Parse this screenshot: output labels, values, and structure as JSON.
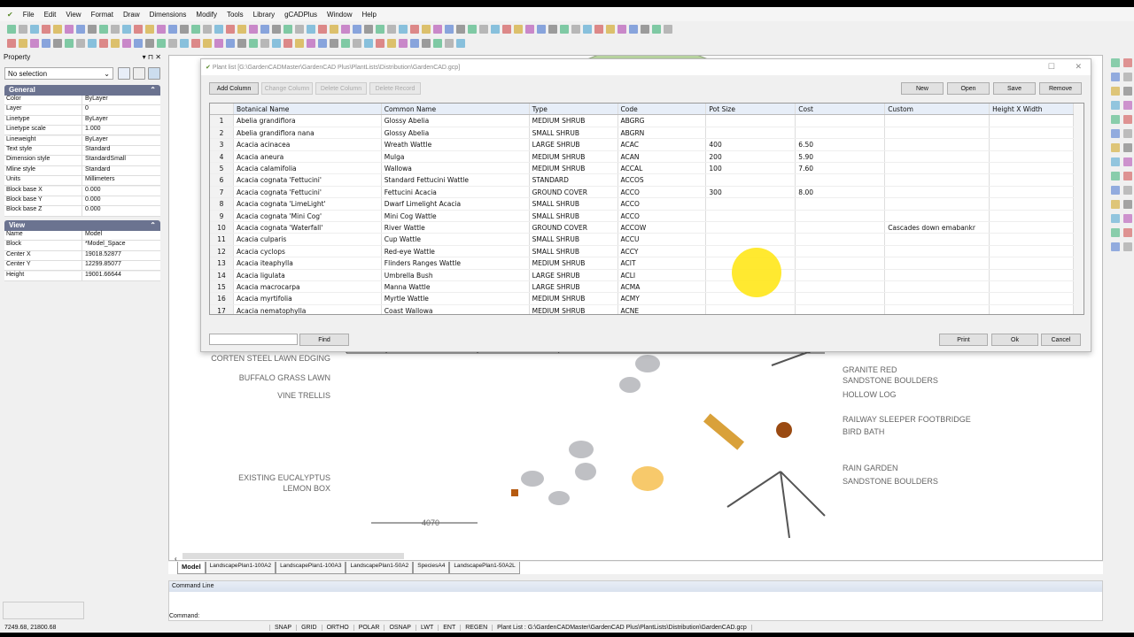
{
  "menu": [
    "File",
    "Edit",
    "View",
    "Format",
    "Draw",
    "Dimensions",
    "Modify",
    "Tools",
    "Library",
    "gCADPlus",
    "Window",
    "Help"
  ],
  "property": {
    "title": "Property",
    "selection": "No selection",
    "general_label": "General",
    "general": [
      [
        "Color",
        "ByLayer"
      ],
      [
        "Layer",
        "0"
      ],
      [
        "Linetype",
        "ByLayer"
      ],
      [
        "Linetype scale",
        "1.000"
      ],
      [
        "Lineweight",
        "ByLayer"
      ],
      [
        "Text style",
        "Standard"
      ],
      [
        "Dimension style",
        "StandardSmall"
      ],
      [
        "Mline style",
        "Standard"
      ],
      [
        "Units",
        "Millimeters"
      ],
      [
        "Block base X",
        "0.000"
      ],
      [
        "Block base Y",
        "0.000"
      ],
      [
        "Block base Z",
        "0.000"
      ]
    ],
    "view_label": "View",
    "view": [
      [
        "Name",
        "Model"
      ],
      [
        "Block",
        "*Model_Space"
      ],
      [
        "Center X",
        "19018.52877"
      ],
      [
        "Center Y",
        "12299.85077"
      ],
      [
        "Height",
        "19001.66644"
      ]
    ]
  },
  "dialog": {
    "title": "Plant list [G:\\GardenCADMaster\\GardenCAD Plus\\PlantLists\\Distribution\\GardenCAD.gcp]",
    "buttons_left": [
      "Add Column",
      "Change Column",
      "Delete Column",
      "Delete Record"
    ],
    "buttons_right": [
      "New",
      "Open",
      "Save",
      "Remove"
    ],
    "find": "Find",
    "print": "Print",
    "ok": "Ok",
    "cancel": "Cancel",
    "columns": [
      "Botanical Name",
      "Common Name",
      "Type",
      "Code",
      "Pot Size",
      "Cost",
      "Custom",
      "Height X Width"
    ],
    "rows": [
      [
        "1",
        "Abelia grandiflora",
        "Glossy Abelia",
        "MEDIUM SHRUB",
        "ABGRG",
        "",
        "",
        "",
        ""
      ],
      [
        "2",
        "Abelia grandiflora nana",
        "Glossy Abelia",
        "SMALL SHRUB",
        "ABGRN",
        "",
        "",
        "",
        ""
      ],
      [
        "3",
        "Acacia acinacea",
        "Wreath Wattle",
        "LARGE SHRUB",
        "ACAC",
        "400",
        "6.50",
        "",
        ""
      ],
      [
        "4",
        "Acacia aneura",
        "Mulga",
        "MEDIUM SHRUB",
        "ACAN",
        "200",
        "5.90",
        "",
        ""
      ],
      [
        "5",
        "Acacia calamifolia",
        "Wallowa",
        "MEDIUM SHRUB",
        "ACCAL",
        "100",
        "7.60",
        "",
        ""
      ],
      [
        "6",
        "Acacia cognata 'Fettucini'",
        "Standard Fettucini Wattle",
        "STANDARD",
        "ACCOS",
        "",
        "",
        "",
        ""
      ],
      [
        "7",
        "Acacia cognata 'Fettucini'",
        "Fettucini Acacia",
        "GROUND COVER",
        "ACCO",
        "300",
        "8.00",
        "",
        ""
      ],
      [
        "8",
        "Acacia cognata 'LimeLight'",
        "Dwarf Limelight Acacia",
        "SMALL SHRUB",
        "ACCO",
        "",
        "",
        "",
        ""
      ],
      [
        "9",
        "Acacia cognata 'Mini Cog'",
        "Mini Cog Wattle",
        "SMALL SHRUB",
        "ACCO",
        "",
        "",
        "",
        ""
      ],
      [
        "10",
        "Acacia cognata 'Waterfall'",
        "River Wattle",
        "GROUND COVER",
        "ACCOW",
        "",
        "",
        "Cascades down emabankr",
        ""
      ],
      [
        "11",
        "Acacia culparis",
        "Cup Wattle",
        "SMALL SHRUB",
        "ACCU",
        "",
        "",
        "",
        ""
      ],
      [
        "12",
        "Acacia cyclops",
        "Red-eye Wattle",
        "SMALL SHRUB",
        "ACCY",
        "",
        "",
        "",
        ""
      ],
      [
        "13",
        "Acacia iteaphylla",
        "Flinders Ranges Wattle",
        "MEDIUM SHRUB",
        "ACIT",
        "",
        "",
        "",
        ""
      ],
      [
        "14",
        "Acacia ligulata",
        "Umbrella Bush",
        "LARGE SHRUB",
        "ACLI",
        "",
        "",
        "",
        ""
      ],
      [
        "15",
        "Acacia macrocarpa",
        "Manna Wattle",
        "LARGE SHRUB",
        "ACMA",
        "",
        "",
        "",
        ""
      ],
      [
        "16",
        "Acacia myrtifolia",
        "Myrtle Wattle",
        "MEDIUM SHRUB",
        "ACMY",
        "",
        "",
        "",
        ""
      ],
      [
        "17",
        "Acacia nematophylla",
        "Coast Wallowa",
        "MEDIUM SHRUB",
        "ACNE",
        "",
        "",
        "",
        ""
      ]
    ]
  },
  "drawing": {
    "labels_left": [
      "CORTEN STEEL LAWN EDGING",
      "BUFFALO GRASS LAWN",
      "VINE TRELLIS",
      "EXISTING EUCALYPTUS",
      "LEMON BOX"
    ],
    "labels_right": [
      "GRANITE RED",
      "SANDSTONE BOULDERS",
      "HOLLOW LOG",
      "RAILWAY SLEEPER FOOTBRIDGE",
      "BIRD BATH",
      "RAIN GARDEN",
      "SANDSTONE BOULDERS"
    ],
    "dimension": "4070"
  },
  "tabs": [
    "Model",
    "LandscapePlan1-100A2",
    "LandscapePlan1-100A3",
    "LandscapePlan1-50A2",
    "SpeciesA4",
    "LandscapePlan1-50A2L"
  ],
  "command": {
    "title": "Command Line",
    "prompt": "Command:"
  },
  "status": {
    "coords": "7249.68, 21800.68",
    "toggles": [
      "SNAP",
      "GRID",
      "ORTHO",
      "POLAR",
      "OSNAP",
      "LWT",
      "ENT",
      "REGEN"
    ],
    "message": "Plant List : G:\\GardenCADMaster\\GardenCAD Plus\\PlantLists\\Distribution\\GardenCAD.gcp"
  }
}
